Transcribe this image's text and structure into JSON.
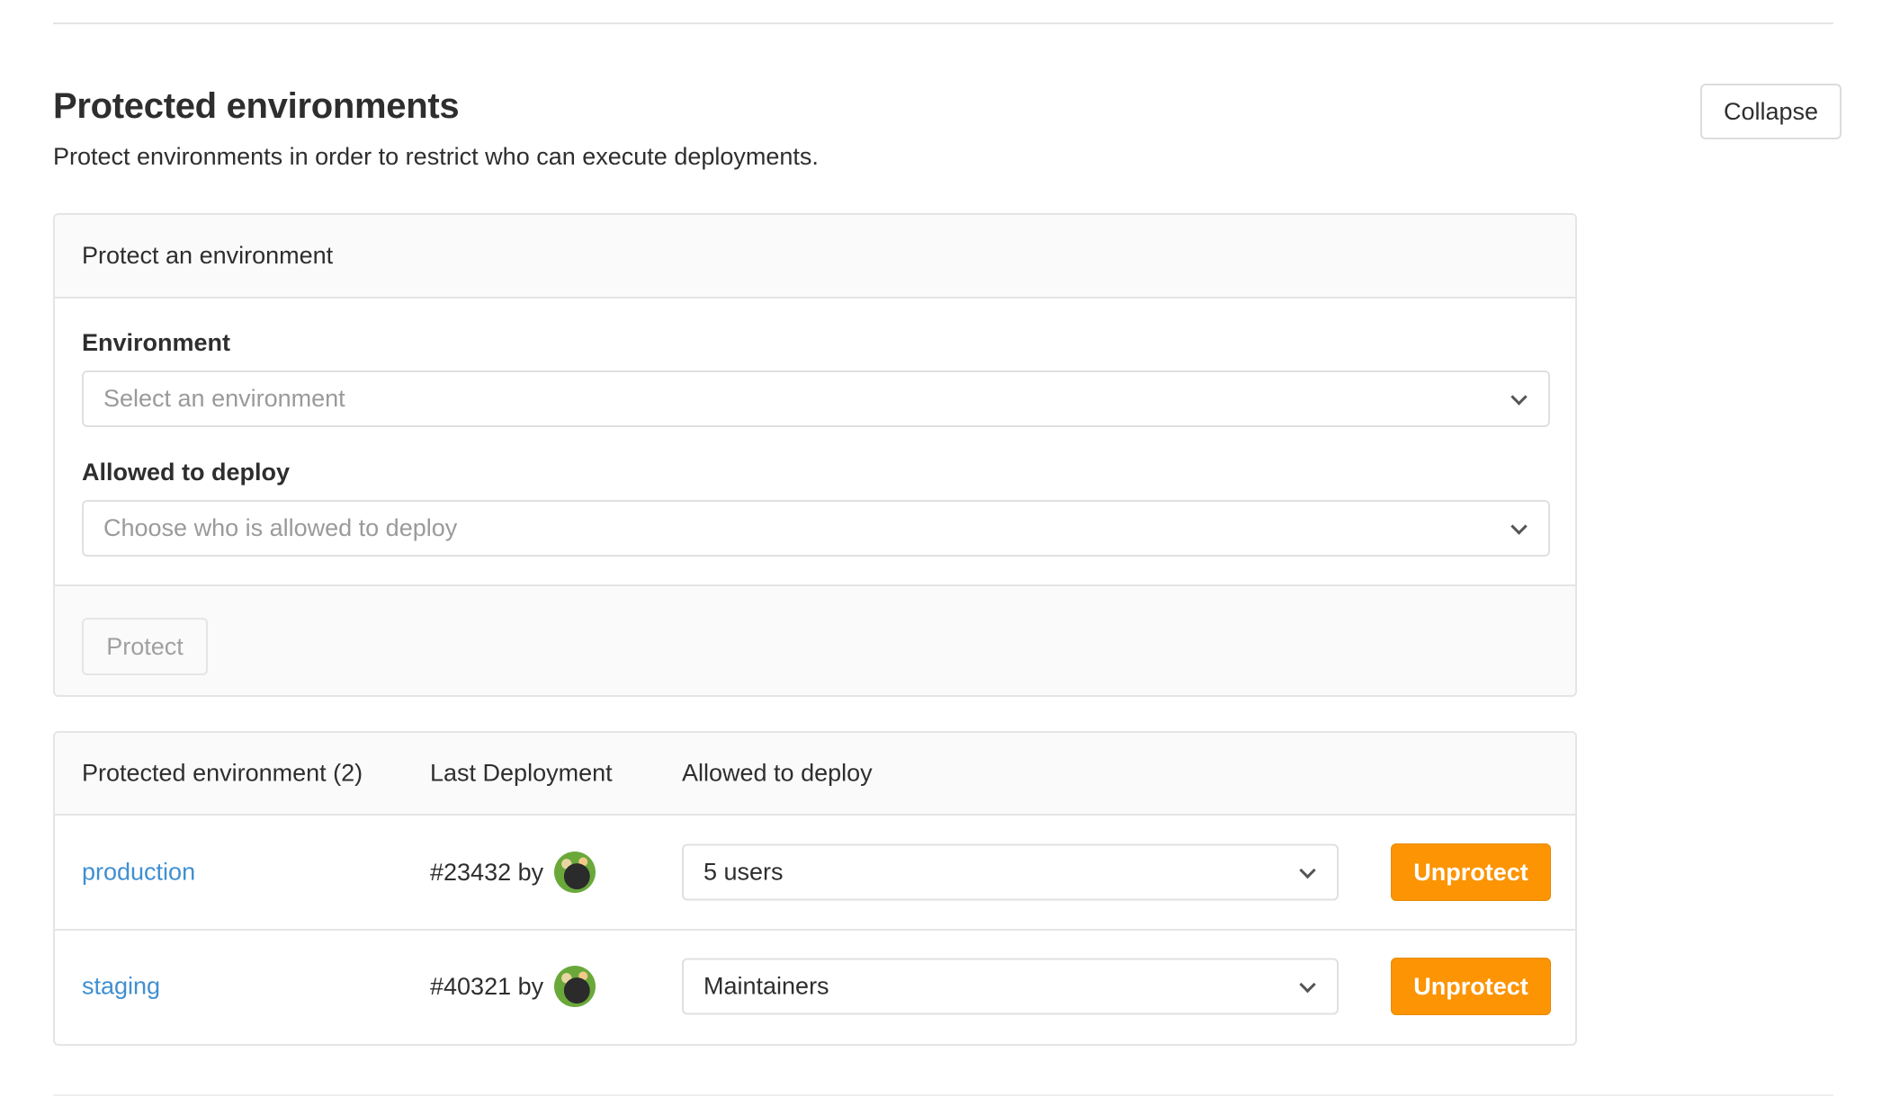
{
  "section": {
    "title": "Protected environments",
    "description": "Protect environments in order to restrict who can execute deployments.",
    "collapse_label": "Collapse"
  },
  "form": {
    "header": "Protect an environment",
    "environment_label": "Environment",
    "environment_placeholder": "Select an environment",
    "allowed_label": "Allowed to deploy",
    "allowed_placeholder": "Choose who is allowed to deploy",
    "protect_label": "Protect"
  },
  "table": {
    "columns": [
      "Protected environment (2)",
      "Last Deployment",
      "Allowed to deploy"
    ],
    "rows": [
      {
        "environment": "production",
        "deployment": "#23432 by",
        "allowed": "5 users",
        "action": "Unprotect"
      },
      {
        "environment": "staging",
        "deployment": "#40321 by",
        "allowed": "Maintainers",
        "action": "Unprotect"
      }
    ]
  },
  "colors": {
    "accent_warning": "#fc9403",
    "link": "#3f8fd2"
  }
}
